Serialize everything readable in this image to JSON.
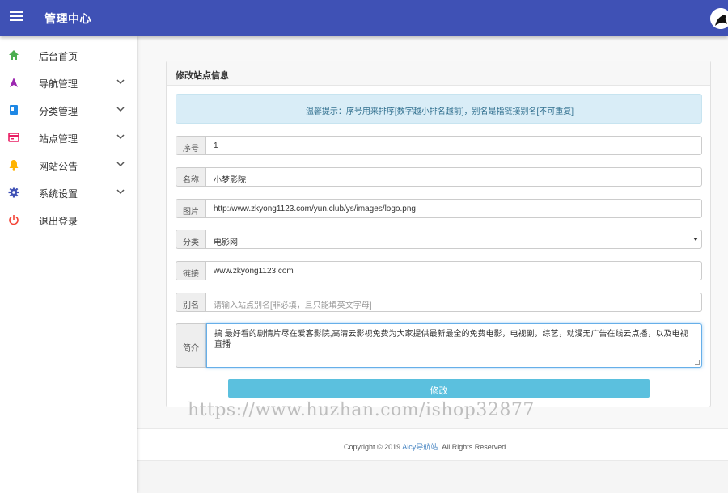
{
  "header": {
    "title": "管理中心",
    "menu_icon": "hamburger-icon",
    "avatar_icon": "user-avatar"
  },
  "sidebar": {
    "items": [
      {
        "label": "后台首页",
        "icon": "home-icon",
        "color": "#4caf50",
        "expandable": false
      },
      {
        "label": "导航管理",
        "icon": "navigation-icon",
        "color": "#9c27b0",
        "expandable": true
      },
      {
        "label": "分类管理",
        "icon": "book-icon",
        "color": "#1e88e5",
        "expandable": true
      },
      {
        "label": "站点管理",
        "icon": "site-card-icon",
        "color": "#e91e63",
        "expandable": true
      },
      {
        "label": "网站公告",
        "icon": "bell-icon",
        "color": "#ffb300",
        "expandable": true
      },
      {
        "label": "系统设置",
        "icon": "gear-icon",
        "color": "#3f51b5",
        "expandable": true
      },
      {
        "label": "退出登录",
        "icon": "power-icon",
        "color": "#f44336",
        "expandable": false
      }
    ]
  },
  "panel": {
    "title": "修改站点信息",
    "notice": "温馨提示：序号用来排序[数字越小排名越前]，别名是指链接别名[不可重复]"
  },
  "form": {
    "order": {
      "label": "序号",
      "value": "1"
    },
    "name": {
      "label": "名称",
      "value": "小梦影院"
    },
    "image": {
      "label": "图片",
      "value": "http:/www.zkyong1123.com/yun.club/ys/images/logo.png"
    },
    "category": {
      "label": "分类",
      "value": "电影网"
    },
    "link": {
      "label": "链接",
      "value": "www.zkyong1123.com"
    },
    "alias": {
      "label": "别名",
      "value": "",
      "placeholder": "请输入站点别名[非必填，且只能填英文字母]"
    },
    "intro": {
      "label": "简介",
      "value": "搞 最好看的剧情片尽在爱客影院,高清云影视免费为大家提供最新最全的免费电影，电视剧，综艺，动漫无广告在线云点播，以及电视直播"
    },
    "submit_label": "修改"
  },
  "footer": {
    "prefix": "Copyright © 2019 ",
    "link": "Aicy导航站",
    "suffix": ". All Rights Reserved."
  },
  "watermark": "https://www.huzhan.com/ishop32877",
  "colors": {
    "header": "#3f51b5",
    "accent_button": "#5bc0de",
    "alert_bg": "#d9edf7",
    "alert_text": "#31708f"
  }
}
